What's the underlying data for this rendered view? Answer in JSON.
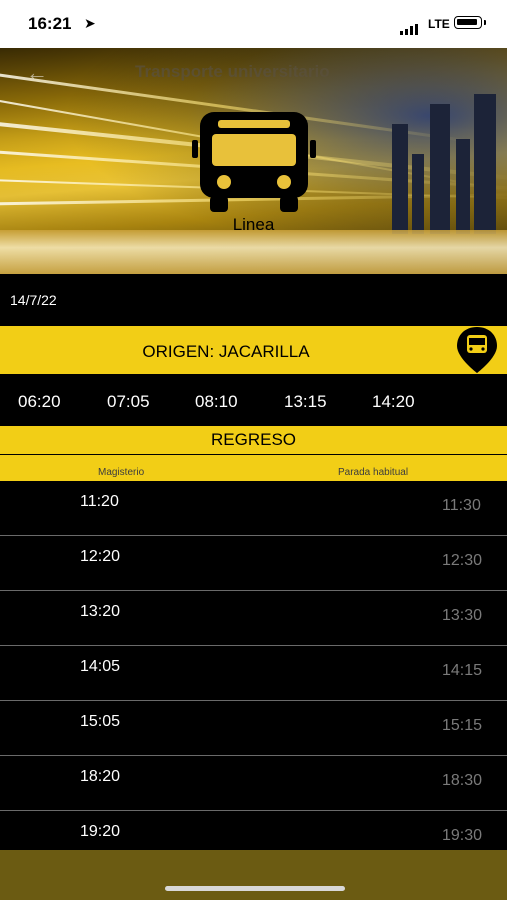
{
  "status": {
    "time": "16:21",
    "network": "LTE"
  },
  "header": {
    "title": "Transporte universitario",
    "line_label": "Linea"
  },
  "date": "14/7/22",
  "origin": {
    "label": "ORIGEN: JACARILLA",
    "times": [
      "06:20",
      "07:05",
      "08:10",
      "13:15",
      "14:20"
    ]
  },
  "return": {
    "label": "REGRESO",
    "col_departure": "Magisterio",
    "col_stop": "Parada habitual",
    "rows": [
      {
        "dep": "11:20",
        "arr": "11:30"
      },
      {
        "dep": "12:20",
        "arr": "12:30"
      },
      {
        "dep": "13:20",
        "arr": "13:30"
      },
      {
        "dep": "14:05",
        "arr": "14:15"
      },
      {
        "dep": "15:05",
        "arr": "15:15"
      },
      {
        "dep": "18:20",
        "arr": "18:30"
      },
      {
        "dep": "19:20",
        "arr": "19:30"
      }
    ]
  },
  "colors": {
    "accent": "#f2ce16",
    "background": "#000000"
  }
}
